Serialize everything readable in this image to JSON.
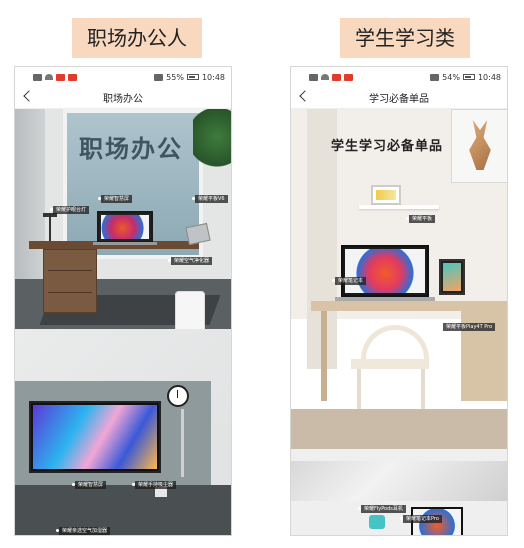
{
  "categories": {
    "left": "职场办公人",
    "right": "学生学习类"
  },
  "status_bar": {
    "left": {
      "battery_pct": "55%",
      "time": "10:48"
    },
    "right": {
      "battery_pct": "54%",
      "time": "10:48"
    }
  },
  "pages": {
    "left": {
      "title": "职场办公",
      "heading": "职场办公",
      "tags": {
        "laptop": "荣耀智慧屏",
        "lamp": "荣耀护眼台灯",
        "tablet": "荣耀平板V6",
        "purifier": "荣耀空气净化器",
        "tv": "荣耀智慧屏",
        "vacuum": "荣耀手持吸尘器",
        "bottom": "荣耀亲选空气加湿器"
      }
    },
    "right": {
      "title": "学习必备单品",
      "heading": "学生学习必备单品",
      "tags": {
        "tablet": "荣耀平板",
        "laptop": "荣耀笔记本",
        "tablet_pro": "荣耀平板Play4T Pro",
        "flypod": "荣耀FlyPods耳机",
        "notebook_pro": "荣耀笔记本Pro"
      }
    }
  }
}
